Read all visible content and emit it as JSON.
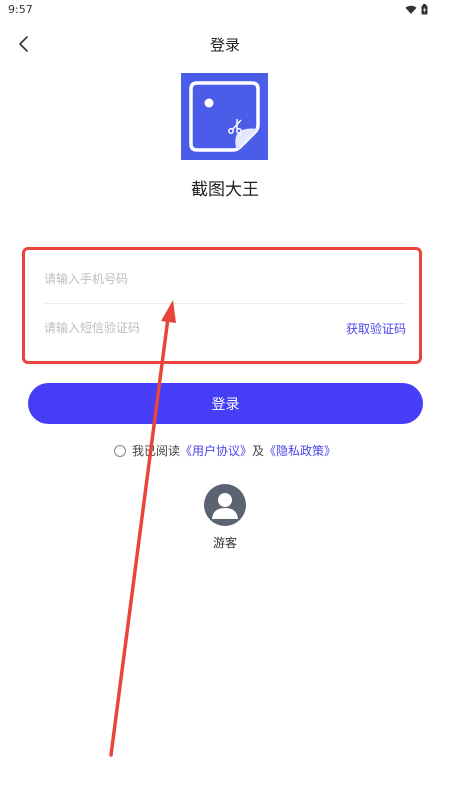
{
  "status_bar": {
    "time": "9:57"
  },
  "header": {
    "title": "登录"
  },
  "app": {
    "name": "截图大王"
  },
  "form": {
    "phone_placeholder": "请输入手机号码",
    "code_placeholder": "请输入短信验证码",
    "get_code_label": "获取验证码"
  },
  "login_button": {
    "label": "登录"
  },
  "agreement": {
    "prefix": "我已阅读",
    "user_agreement": "《用户协议》",
    "conjunction": "及",
    "privacy_policy": "《隐私政策》",
    "checked": false
  },
  "guest": {
    "label": "游客"
  },
  "colors": {
    "accent": "#463df6",
    "link": "#4a45ea",
    "annotation": "#e8453c",
    "logo_bg": "#4b5ce8"
  }
}
